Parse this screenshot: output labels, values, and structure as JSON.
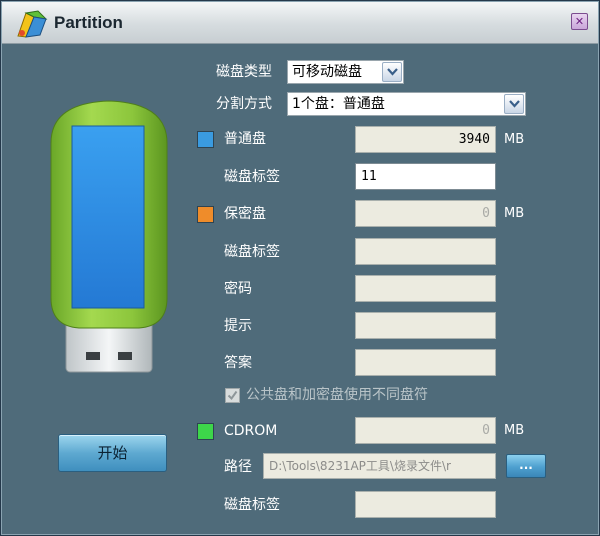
{
  "window": {
    "title": "Partition",
    "close_glyph": "✕"
  },
  "icons": {
    "app": "partition-app-icon",
    "close": "close-icon",
    "usb": "usb-drive-icon",
    "check": "checkmark-icon",
    "dropdown": "chevron-down-icon"
  },
  "colors": {
    "window_bg": "#4f6b7a",
    "normal_disk": "#3a9be0",
    "secure_disk": "#ef8c2a",
    "cdrom": "#3dd64a",
    "usb_body": "#8dc63f",
    "usb_screen": "#2f8fe6"
  },
  "form": {
    "disk_type": {
      "label": "磁盘类型",
      "value": "可移动磁盘"
    },
    "split_mode": {
      "label": "分割方式",
      "value": "1个盘：普通盘"
    },
    "normal_disk": {
      "label": "普通盘",
      "size": "3940",
      "unit": "MB",
      "tag_label": "磁盘标签",
      "tag_value": "11"
    },
    "secure_disk": {
      "label": "保密盘",
      "size": "0",
      "unit": "MB",
      "tag_label": "磁盘标签",
      "tag_value": "",
      "password_label": "密码",
      "password_value": "",
      "hint_label": "提示",
      "hint_value": "",
      "answer_label": "答案",
      "answer_value": ""
    },
    "separate_letters": {
      "label": "公共盘和加密盘使用不同盘符",
      "checked": true
    },
    "cdrom": {
      "label": "CDROM",
      "size": "0",
      "unit": "MB",
      "path_label": "路径",
      "path_value": "D:\\Tools\\8231AP工具\\烧录文件\\r",
      "browse_label": "...",
      "tag_label": "磁盘标签",
      "tag_value": ""
    }
  },
  "buttons": {
    "start_label": "开始"
  }
}
